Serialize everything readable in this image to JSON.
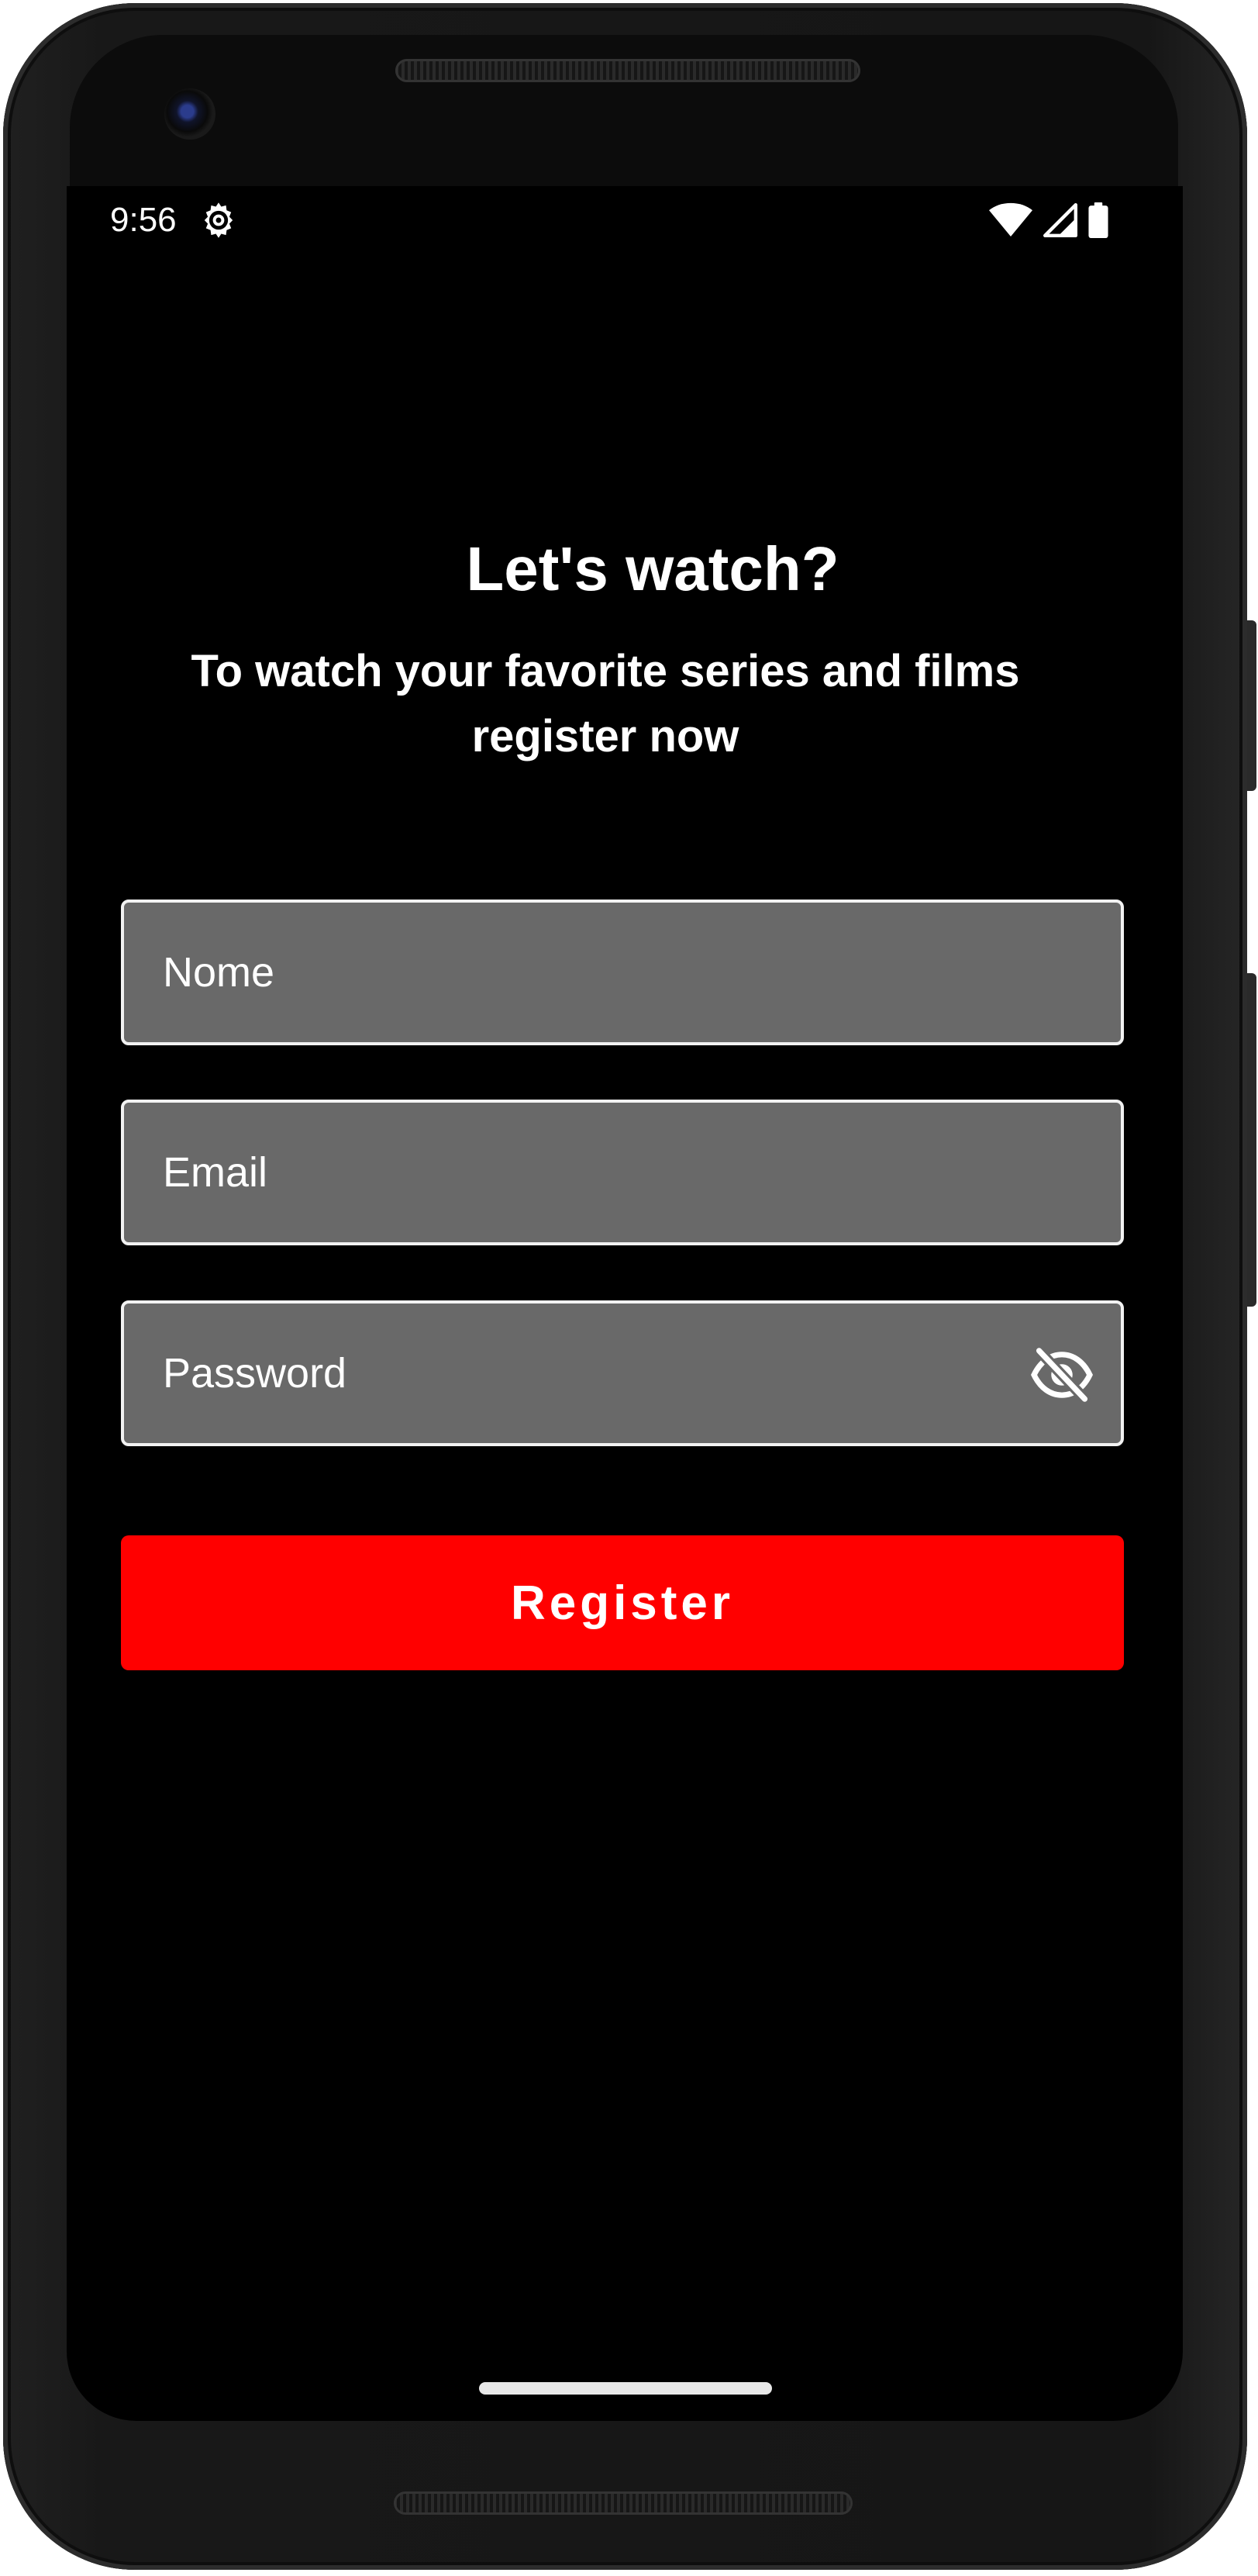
{
  "status_bar": {
    "time": "9:56",
    "icons": [
      "gear-icon",
      "wifi-icon",
      "cellular-signal-icon",
      "battery-icon"
    ]
  },
  "header": {
    "title": "Let's watch?",
    "subtitle": "To watch your favorite series and films register now"
  },
  "form": {
    "name_placeholder": "Nome",
    "email_placeholder": "Email",
    "password_placeholder": "Password",
    "password_toggle_icon": "eye-off-icon",
    "register_label": "Register"
  },
  "colors": {
    "background": "#000000",
    "field_fill": "#696969",
    "field_border": "#f2f2f2",
    "accent": "#ff0000",
    "text": "#ffffff"
  }
}
